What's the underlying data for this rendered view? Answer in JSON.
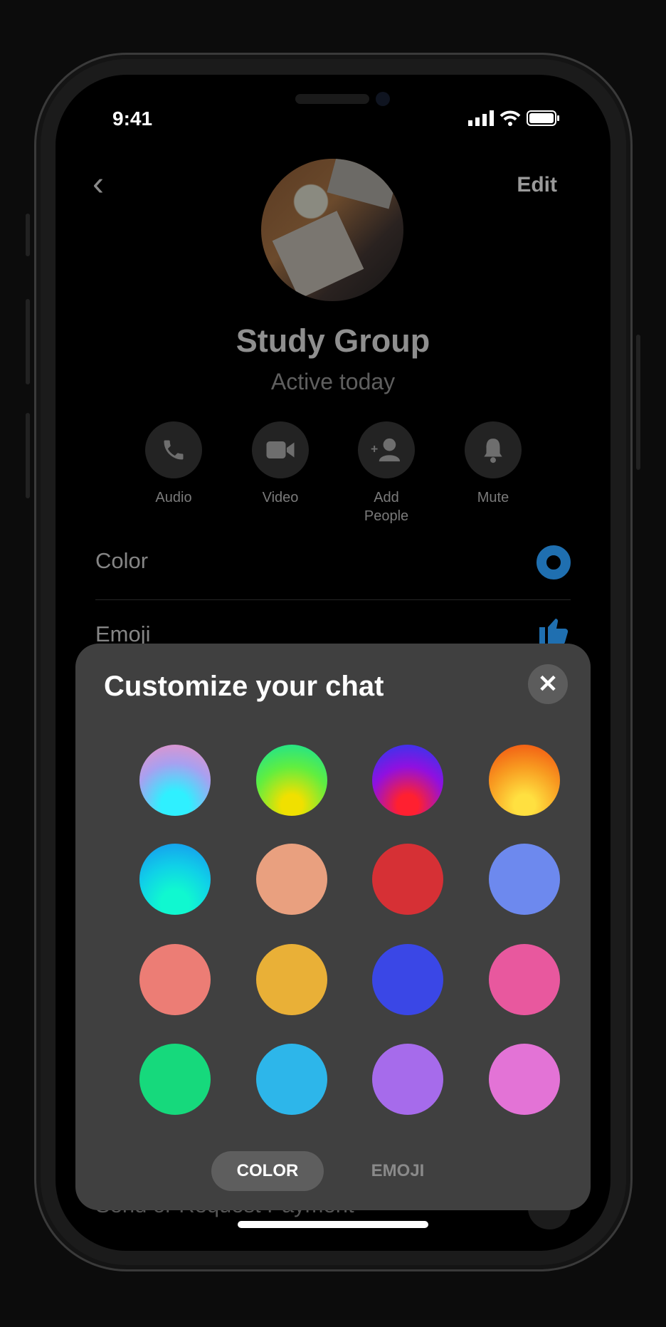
{
  "status_bar": {
    "time": "9:41",
    "icons": [
      "cellular-signal-icon",
      "wifi-icon",
      "battery-icon"
    ]
  },
  "header": {
    "back_icon": "chevron-left-icon",
    "edit_label": "Edit"
  },
  "profile": {
    "name": "Study Group",
    "status": "Active today"
  },
  "actions": [
    {
      "label": "Audio",
      "icon": "phone-icon"
    },
    {
      "label": "Video",
      "icon": "video-camera-icon"
    },
    {
      "label": "Add\nPeople",
      "icon": "add-person-icon"
    },
    {
      "label": "Mute",
      "icon": "bell-icon"
    }
  ],
  "settings": [
    {
      "label": "Color",
      "icon": "color-ring-icon",
      "accent": "#1f6fb0"
    },
    {
      "label": "Emoji",
      "icon": "thumbs-up-icon",
      "accent": "#1f6fb0"
    },
    {
      "label": "Send or Request Payment",
      "icon": "payment-icon"
    }
  ],
  "sheet": {
    "title": "Customize your chat",
    "close_icon": "close-icon",
    "swatches": [
      "radial-gradient(circle at 50% 85%,#2ff0ff 0 20%,#a8a0f0 60%,#f090c0 100%)",
      "radial-gradient(circle at 50% 85%,#f0e000 0 15%,#60ee40 55%,#10e0a0 100%)",
      "radial-gradient(circle at 50% 85%,#ff2030 0 15%,#9010e0 55%,#2040f0 100%)",
      "radial-gradient(circle at 50% 85%,#ffe040 0 15%,#f89a20 55%,#f04a10 100%)",
      "radial-gradient(circle at 50% 85%,#10f8d0 0 20%,#10d0e8 55%,#1890f0 100%)",
      "#E9A07F",
      "#D63035",
      "#6D89EE",
      "#EC7D75",
      "#E9B037",
      "#3A47E6",
      "#E8589E",
      "#16D97C",
      "#2DB6EA",
      "#A66BEB",
      "#E373D6"
    ],
    "tabs": [
      {
        "label": "COLOR",
        "active": true
      },
      {
        "label": "EMOJI",
        "active": false
      }
    ]
  }
}
